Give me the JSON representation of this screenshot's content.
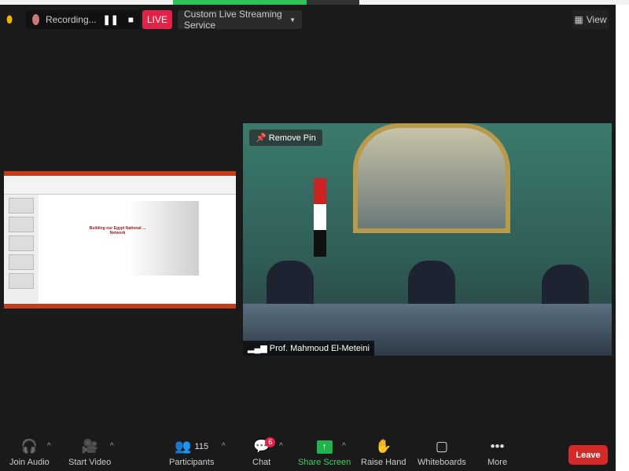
{
  "top": {
    "recording_label": "Recording...",
    "live_label": "LIVE",
    "stream_service": "Custom Live Streaming Service",
    "view_label": "View"
  },
  "shared_slide": {
    "title": "Building our Egypt National ... Network"
  },
  "video": {
    "pin_label": "Remove Pin",
    "speaker_name": "Prof. Mahmoud El-Meteini"
  },
  "toolbar": {
    "join_audio": "Join Audio",
    "start_video": "Start Video",
    "participants": "Participants",
    "participant_count": "115",
    "chat": "Chat",
    "chat_badge": "6",
    "share_screen": "Share Screen",
    "raise_hand": "Raise Hand",
    "whiteboards": "Whiteboards",
    "more": "More",
    "leave": "Leave"
  },
  "colors": {
    "live": "#e02347",
    "share": "#23b14d",
    "leave": "#d42a2a"
  }
}
